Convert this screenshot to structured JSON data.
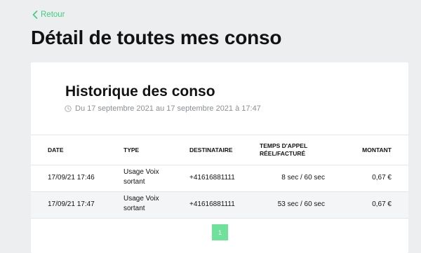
{
  "nav": {
    "back_label": "Retour"
  },
  "page": {
    "title": "Détail de toutes mes conso"
  },
  "history": {
    "title": "Historique des conso",
    "date_range": "Du 17 septembre 2021 au 17 septembre 2021 à 17:47"
  },
  "table": {
    "headers": {
      "date": "DATE",
      "type": "TYPE",
      "destinataire": "DESTINATAIRE",
      "temps_line1": "TEMPS D'APPEL",
      "temps_line2": "RÉEL/FACTURÉ",
      "montant": "MONTANT"
    },
    "rows": [
      {
        "date": "17/09/21 17:46",
        "type": "Usage Voix sortant",
        "destinataire": "+41616881111",
        "temps": "8 sec / 60 sec",
        "montant": "0,67 €"
      },
      {
        "date": "17/09/21 17:47",
        "type": "Usage Voix sortant",
        "destinataire": "+41616881111",
        "temps": "53 sec / 60 sec",
        "montant": "0,67 €"
      }
    ]
  },
  "pagination": {
    "current_page": "1"
  },
  "colors": {
    "accent": "#3ecf7e",
    "page_button": "#6ee29a",
    "background": "#eceef0",
    "muted_text": "#8a8f96"
  }
}
